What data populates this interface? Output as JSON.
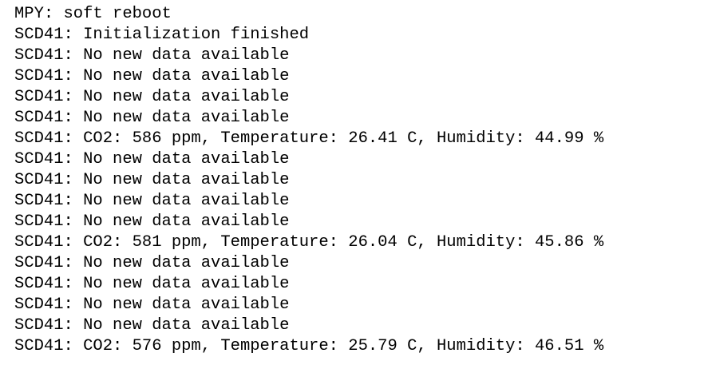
{
  "terminal": {
    "lines": [
      "MPY: soft reboot",
      "SCD41: Initialization finished",
      "SCD41: No new data available",
      "SCD41: No new data available",
      "SCD41: No new data available",
      "SCD41: No new data available",
      "SCD41: CO2: 586 ppm, Temperature: 26.41 C, Humidity: 44.99 %",
      "SCD41: No new data available",
      "SCD41: No new data available",
      "SCD41: No new data available",
      "SCD41: No new data available",
      "SCD41: CO2: 581 ppm, Temperature: 26.04 C, Humidity: 45.86 %",
      "SCD41: No new data available",
      "SCD41: No new data available",
      "SCD41: No new data available",
      "SCD41: No new data available",
      "SCD41: CO2: 576 ppm, Temperature: 25.79 C, Humidity: 46.51 %"
    ]
  }
}
